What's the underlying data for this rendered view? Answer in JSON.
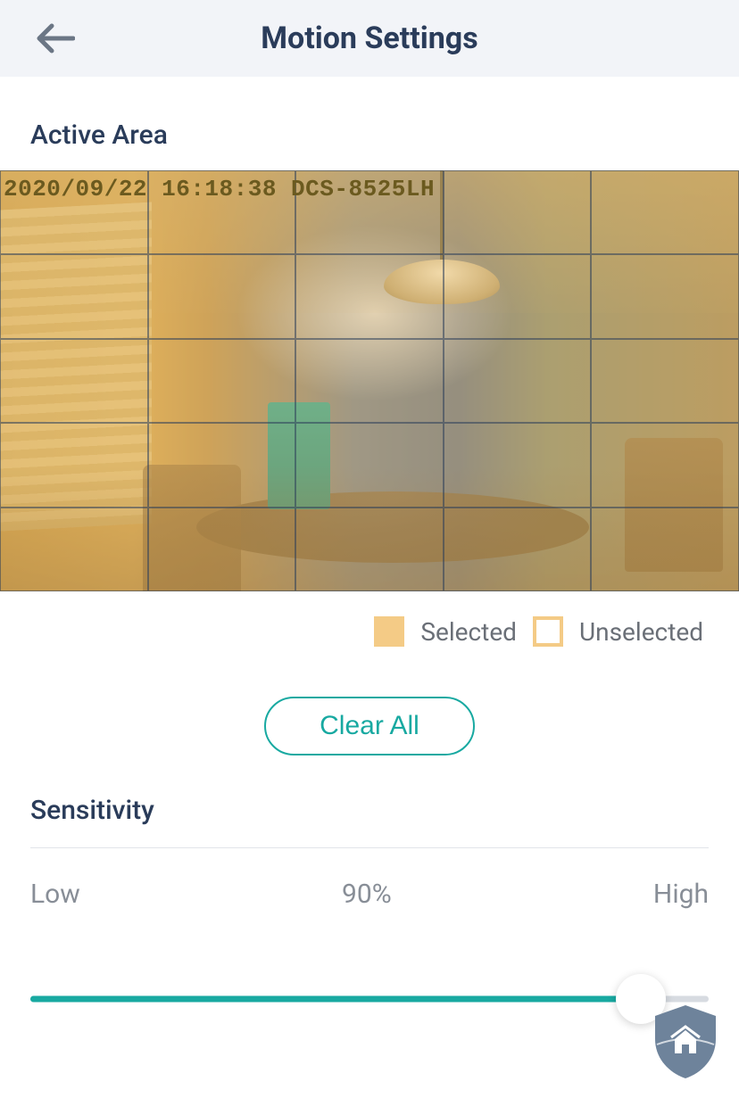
{
  "header": {
    "title": "Motion Settings"
  },
  "active_area": {
    "label": "Active Area",
    "osd_text": "2020/09/22 16:18:38 DCS-8525LH",
    "grid": {
      "rows": 5,
      "cols": 5
    },
    "legend": {
      "selected_label": "Selected",
      "unselected_label": "Unselected"
    },
    "clear_label": "Clear All"
  },
  "sensitivity": {
    "label": "Sensitivity",
    "low_label": "Low",
    "high_label": "High",
    "value_label": "90%",
    "value": 90
  },
  "colors": {
    "accent": "#18a9a1",
    "heading": "#2a3c5a",
    "muted": "#888e97",
    "selected_swatch": "#f4cb86"
  }
}
